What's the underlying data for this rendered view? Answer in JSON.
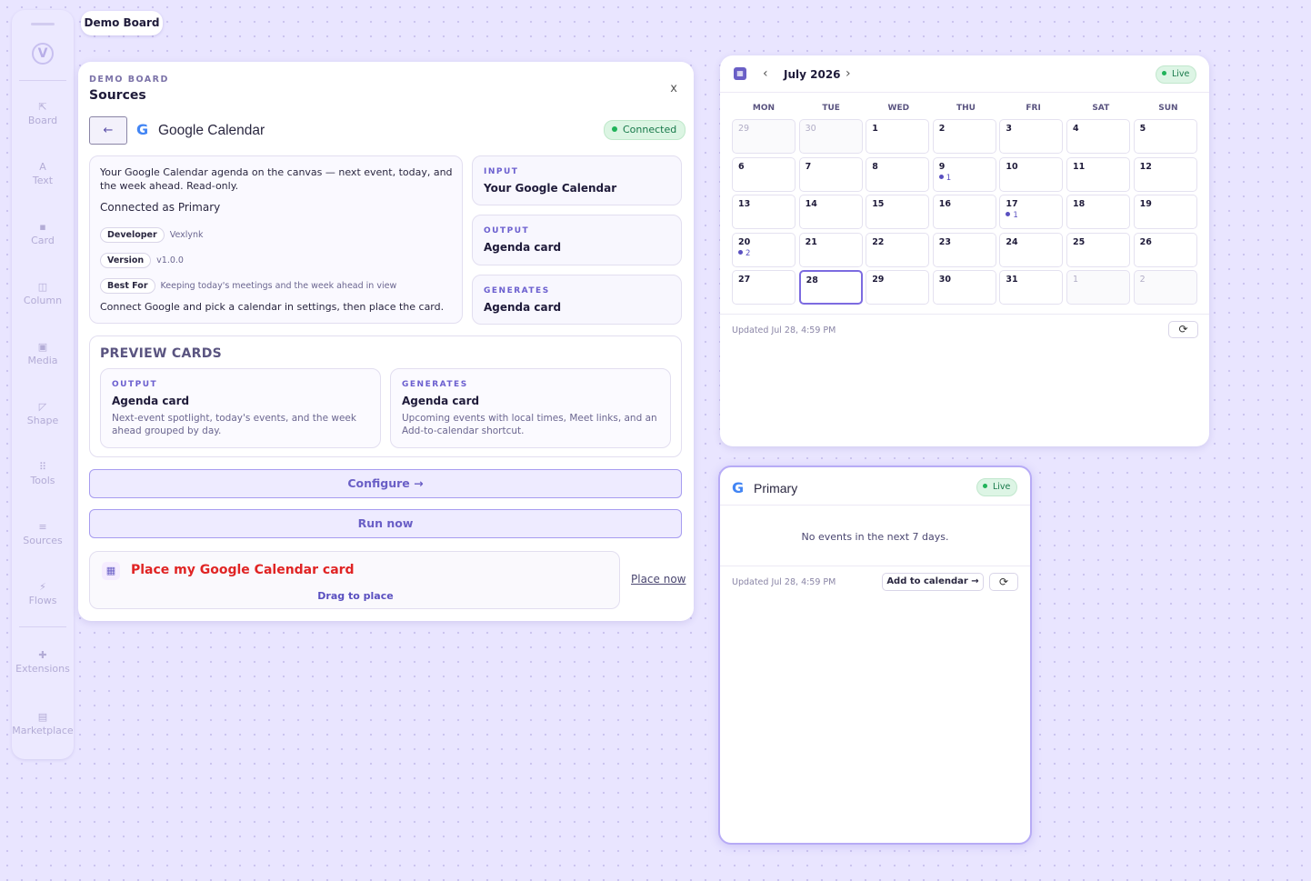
{
  "sidebar": {
    "logo": "V",
    "items": [
      {
        "icon": "⇱",
        "label": "Board"
      },
      {
        "icon": "A",
        "label": "Text"
      },
      {
        "icon": "▪",
        "label": "Card"
      },
      {
        "icon": "◫",
        "label": "Column"
      },
      {
        "icon": "▣",
        "label": "Media"
      },
      {
        "icon": "◸",
        "label": "Shape"
      },
      {
        "icon": "⠿",
        "label": "Tools"
      },
      {
        "icon": "≡",
        "label": "Sources"
      },
      {
        "icon": "⚡",
        "label": "Flows"
      },
      {
        "icon": "✚",
        "label": "Extensions"
      },
      {
        "icon": "▤",
        "label": "Marketplace"
      }
    ]
  },
  "board_tab": "Demo Board",
  "panel": {
    "eyebrow": "DEMO BOARD",
    "title": "Sources",
    "close": "x",
    "back": "←",
    "source_name": "Google Calendar",
    "status": "Connected",
    "description": "Your Google Calendar agenda on the canvas — next event, today, and the week ahead. Read-only.",
    "connected_as": "Connected as Primary",
    "developer_label": "Developer",
    "developer_value": "Vexlynk",
    "version_label": "Version",
    "version_value": "v1.0.0",
    "bestfor_label": "Best For",
    "bestfor_value": "Keeping today's meetings and the week ahead in view",
    "instructions": "Connect Google and pick a calendar in settings, then place the card.",
    "input_label": "INPUT",
    "input_value": "Your Google Calendar",
    "output_label": "OUTPUT",
    "output_value": "Agenda card",
    "generates_label": "GENERATES",
    "generates_value": "Agenda card",
    "preview_title": "PREVIEW CARDS",
    "preview_cards": [
      {
        "label": "OUTPUT",
        "title": "Agenda card",
        "desc": "Next-event spotlight, today's events, and the week ahead grouped by day."
      },
      {
        "label": "GENERATES",
        "title": "Agenda card",
        "desc": "Upcoming events with local times, Meet links, and an Add-to-calendar shortcut."
      }
    ],
    "configure": "Configure →",
    "run_now": "Run now",
    "place_title": "Place my Google Calendar card",
    "drag_hint": "Drag to place",
    "place_now": "Place now"
  },
  "calendar": {
    "month": "July 2026",
    "status": "Live",
    "weekdays": [
      "MON",
      "TUE",
      "WED",
      "THU",
      "FRI",
      "SAT",
      "SUN"
    ],
    "days": [
      {
        "n": "29",
        "muted": true
      },
      {
        "n": "30",
        "muted": true
      },
      {
        "n": "1"
      },
      {
        "n": "2"
      },
      {
        "n": "3"
      },
      {
        "n": "4"
      },
      {
        "n": "5"
      },
      {
        "n": "6"
      },
      {
        "n": "7"
      },
      {
        "n": "8"
      },
      {
        "n": "9",
        "events": "1"
      },
      {
        "n": "10"
      },
      {
        "n": "11"
      },
      {
        "n": "12"
      },
      {
        "n": "13"
      },
      {
        "n": "14"
      },
      {
        "n": "15"
      },
      {
        "n": "16"
      },
      {
        "n": "17",
        "events": "1"
      },
      {
        "n": "18"
      },
      {
        "n": "19"
      },
      {
        "n": "20",
        "events": "2"
      },
      {
        "n": "21"
      },
      {
        "n": "22"
      },
      {
        "n": "23"
      },
      {
        "n": "24"
      },
      {
        "n": "25"
      },
      {
        "n": "26"
      },
      {
        "n": "27"
      },
      {
        "n": "28",
        "today": true
      },
      {
        "n": "29"
      },
      {
        "n": "30"
      },
      {
        "n": "31"
      },
      {
        "n": "1",
        "muted": true
      },
      {
        "n": "2",
        "muted": true
      }
    ],
    "updated": "Updated Jul 28, 4:59 PM"
  },
  "primary": {
    "title": "Primary",
    "status": "Live",
    "empty": "No events in the next 7 days.",
    "updated": "Updated Jul 28, 4:59 PM",
    "add_button": "Add to calendar →"
  },
  "colors": {
    "accent": "#6a5fc6",
    "live_green": "#21b35a",
    "place_red": "#e02424",
    "canvas": "#e9e5ff"
  }
}
